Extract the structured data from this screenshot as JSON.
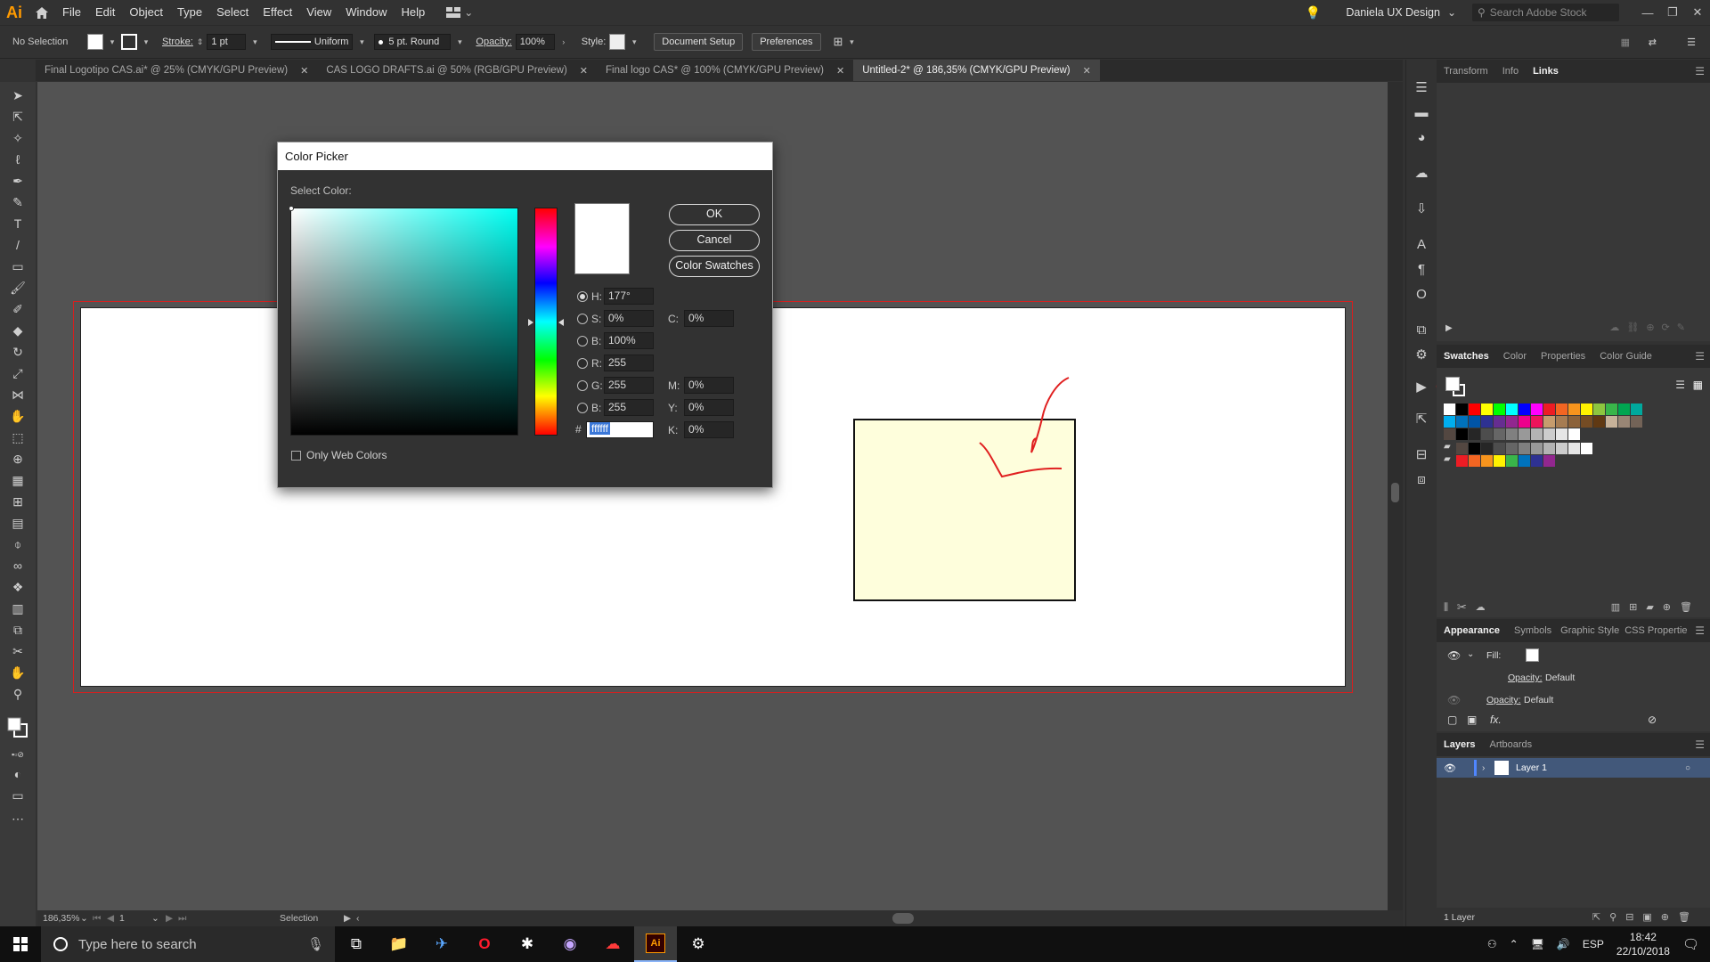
{
  "app": {
    "logo": "Ai",
    "menus": [
      "File",
      "Edit",
      "Object",
      "Type",
      "Select",
      "Effect",
      "View",
      "Window",
      "Help"
    ],
    "account": "Daniela UX Design",
    "search_placeholder": "Search Adobe Stock"
  },
  "control_bar": {
    "selection": "No Selection",
    "stroke_label": "Stroke:",
    "stroke_weight": "1 pt",
    "stroke_profile": "Uniform",
    "brush": "5 pt. Round",
    "opacity_label": "Opacity:",
    "opacity_value": "100%",
    "style_label": "Style:",
    "document_setup": "Document Setup",
    "preferences": "Preferences"
  },
  "tabs": [
    {
      "label": "Final Logotipo CAS.ai* @ 25% (CMYK/GPU Preview)",
      "active": false
    },
    {
      "label": "CAS LOGO DRAFTS.ai @ 50% (RGB/GPU Preview)",
      "active": false
    },
    {
      "label": "Final logo CAS* @ 100% (CMYK/GPU Preview)",
      "active": false
    },
    {
      "label": "Untitled-2* @ 186,35% (CMYK/GPU Preview)",
      "active": true
    }
  ],
  "status_bar": {
    "zoom": "186,35%",
    "artboard": "1",
    "tool": "Selection"
  },
  "color_picker": {
    "title": "Color Picker",
    "select_label": "Select Color:",
    "ok": "OK",
    "cancel": "Cancel",
    "swatches": "Color Swatches",
    "h_label": "H:",
    "h": "177°",
    "s_label": "S:",
    "s": "0%",
    "b_label": "B:",
    "b": "100%",
    "r_label": "R:",
    "r": "255",
    "g_label": "G:",
    "g": "255",
    "bb_label": "B:",
    "bb": "255",
    "hash": "#",
    "hex": "ffffff",
    "c_label": "C:",
    "c": "0%",
    "m_label": "M:",
    "m": "0%",
    "y_label": "Y:",
    "y": "0%",
    "k_label": "K:",
    "k": "0%",
    "web_only": "Only Web Colors"
  },
  "panels": {
    "top_tabs": [
      "Transform",
      "Info",
      "Links"
    ],
    "swatch_tabs": [
      "Swatches",
      "Color",
      "Properties",
      "Color Guide"
    ],
    "appearance_tabs": [
      "Appearance",
      "Symbols",
      "Graphic Style",
      "CSS Propertie"
    ],
    "fill_label": "Fill:",
    "opacity_label_1": "Opacity:",
    "opacity_value_1": "Default",
    "opacity_label_2": "Opacity:",
    "opacity_value_2": "Default",
    "fx": "fx.",
    "layers_tabs": [
      "Layers",
      "Artboards"
    ],
    "layer_name": "Layer 1",
    "layer_count": "1 Layer"
  },
  "swatch_colors": {
    "row1": [
      "#ffffff",
      "#000000",
      "#ff0000",
      "#ffff00",
      "#00ff00",
      "#00ffff",
      "#0000ff",
      "#ff00ff",
      "#ed1c24",
      "#f26522",
      "#f7941d",
      "#fff200",
      "#8dc63f",
      "#39b54a",
      "#00a651",
      "#00a99d"
    ],
    "row2": [
      "#00aeef",
      "#0072bc",
      "#0054a6",
      "#2e3192",
      "#662d91",
      "#92278f",
      "#ec008c",
      "#ed145b",
      "#c69c6d",
      "#a67c52",
      "#8c6239",
      "#754c24",
      "#603913",
      "#c7b299",
      "#998675",
      "#736357"
    ],
    "row3": [
      "#534741",
      "#000000",
      "#262626",
      "#4d4d4d",
      "#666666",
      "#808080",
      "#999999",
      "#b3b3b3",
      "#cccccc",
      "#e6e6e6",
      "#ffffff"
    ],
    "row4": [
      "#ed1c24",
      "#f26522",
      "#f7941d",
      "#fff200",
      "#39b54a",
      "#0072bc",
      "#2e3192",
      "#92278f"
    ]
  },
  "taskbar": {
    "search_placeholder": "Type here to search",
    "lang": "ESP",
    "time": "18:42",
    "date": "22/10/2018"
  }
}
